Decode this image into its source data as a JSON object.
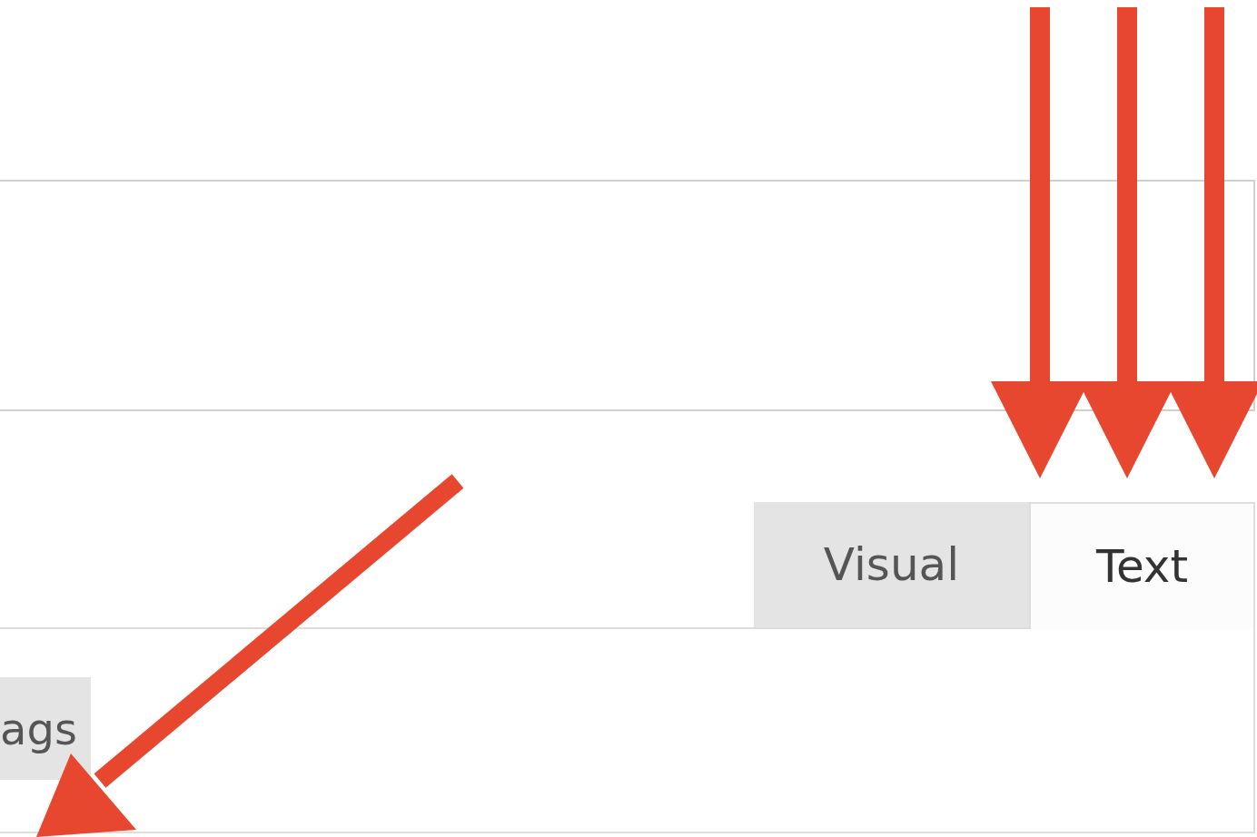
{
  "editor_tabs": [
    {
      "label": "Visual",
      "selected": false
    },
    {
      "label": "Text",
      "selected": true
    }
  ],
  "toolbar": {
    "buttons": [
      "ags"
    ]
  },
  "annotations": [
    {
      "kind": "down_arrow"
    },
    {
      "kind": "down_arrow"
    },
    {
      "kind": "down_arrow"
    },
    {
      "kind": "diagonal_arrow"
    }
  ]
}
